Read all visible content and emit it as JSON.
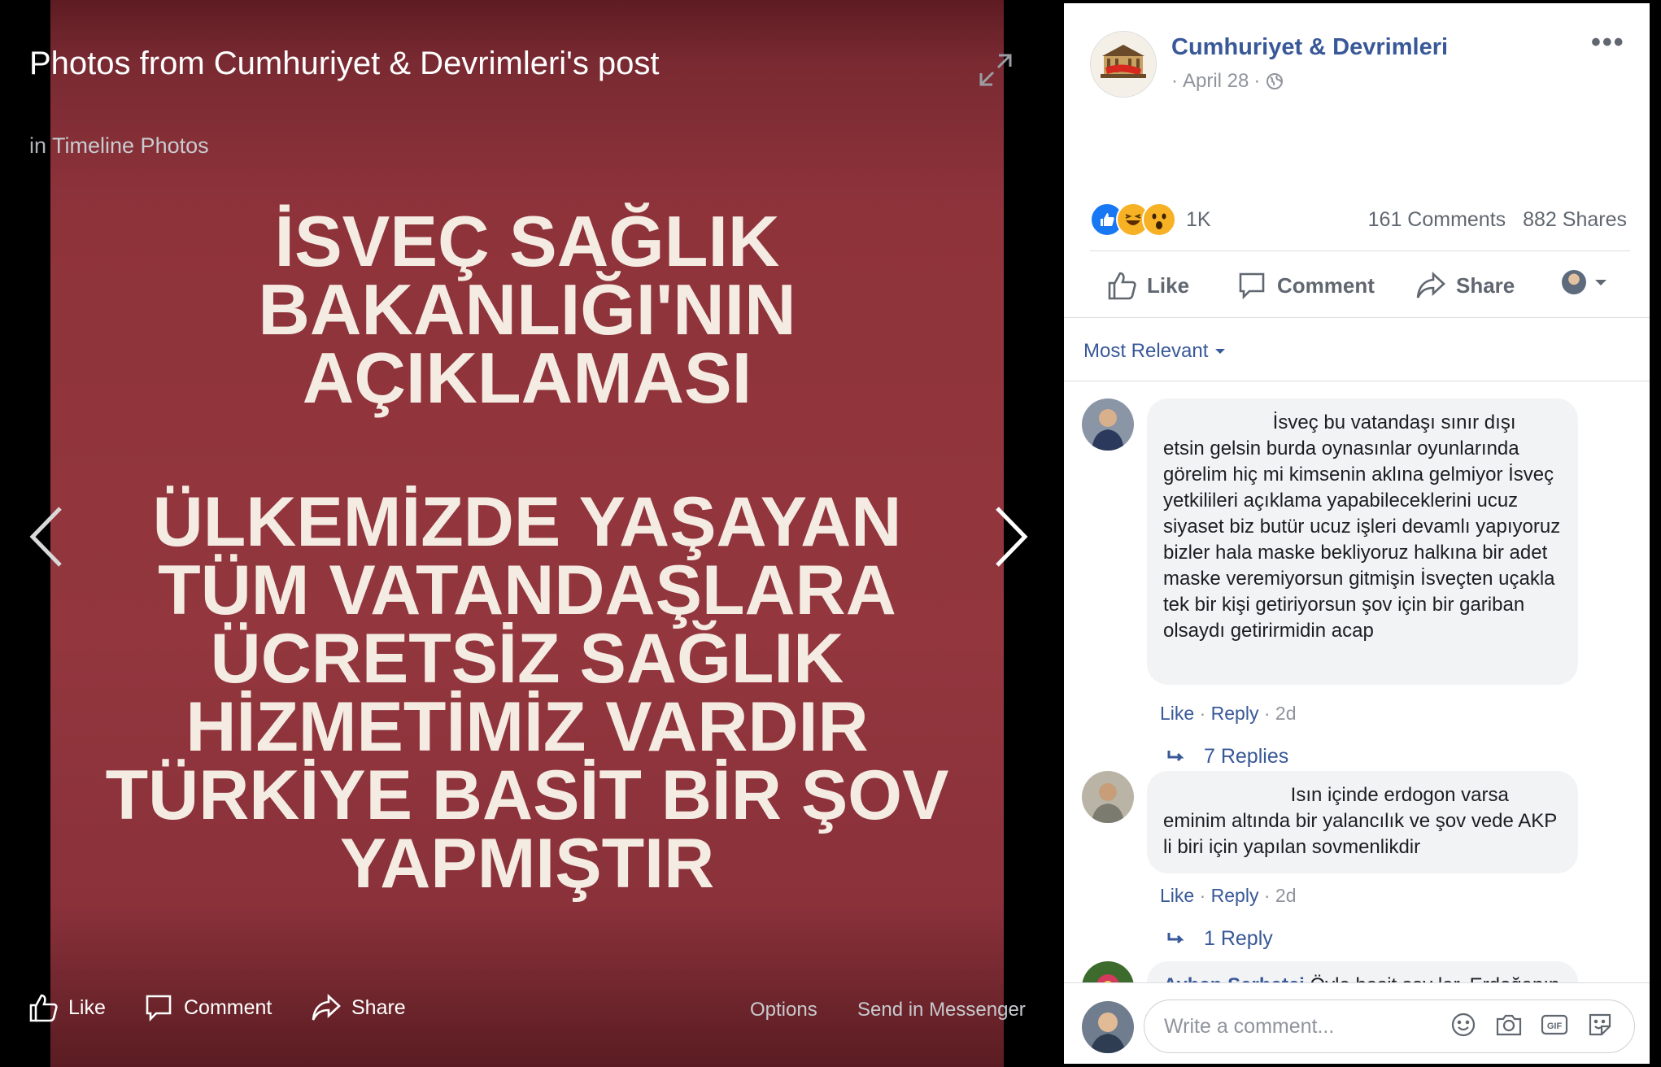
{
  "viewer": {
    "title": "Photos from Cumhuriyet & Devrimleri's post",
    "album_prefix": "in",
    "album_name": "Timeline Photos",
    "photo_text": {
      "block1": [
        "İSVEÇ SAĞLIK",
        "BAKANLIĞI'NIN",
        "AÇIKLAMASI"
      ],
      "block2": [
        "ÜLKEMİZDE YAŞAYAN",
        "TÜM VATANDAŞLARA",
        "ÜCRETSİZ SAĞLIK",
        "HİZMETİMİZ VARDIR",
        "TÜRKİYE BASİT BİR ŞOV",
        "YAPMIŞTIR"
      ]
    },
    "bottom_bar": {
      "like": "Like",
      "comment": "Comment",
      "share": "Share",
      "options": "Options",
      "send_in_messenger": "Send in Messenger"
    }
  },
  "post": {
    "page_name": "Cumhuriyet & Devrimleri",
    "date": "April 28",
    "reactions": {
      "icons": [
        "like-reaction-icon",
        "haha-reaction-icon",
        "wow-reaction-icon"
      ],
      "count": "1K"
    },
    "comments_count": "161 Comments",
    "shares_count": "882 Shares",
    "actions": {
      "like": "Like",
      "comment": "Comment",
      "share": "Share"
    },
    "sort": "Most Relevant"
  },
  "comments": [
    {
      "text": "İsveç bu vatandaşı sınır dışı etsin gelsin burda oynasınlar oyunlarında görelim hiç mi kimsenin aklına gelmiyor İsveç yetkilileri açıklama yapabileceklerini ucuz siyaset biz butür ucuz işleri devamlı yapıyoruz bizler hala maske bekliyoruz halkına bir adet maske veremiyorsun gitmişin İsveçten uçakla tek bir kişi getiriyorsun şov için bir gariban olsaydı getirirmidin acap",
      "like": "Like",
      "reply": "Reply",
      "time": "2d",
      "replies": "7 Replies"
    },
    {
      "text": "Isın içinde erdogon varsa eminim altında bir yalancılık ve şov vede AKP li biri için yapılan sovmenlikdir",
      "like": "Like",
      "reply": "Reply",
      "time": "2d",
      "replies": "1 Reply"
    },
    {
      "author": "Ayhan Serhatçi",
      "text": "Öyle basit şov lar. Erdoğanın"
    }
  ],
  "composer": {
    "placeholder": "Write a comment..."
  },
  "colors": {
    "link": "#385898",
    "photo_bg": "#93363e",
    "like_blue": "#1877f2"
  }
}
